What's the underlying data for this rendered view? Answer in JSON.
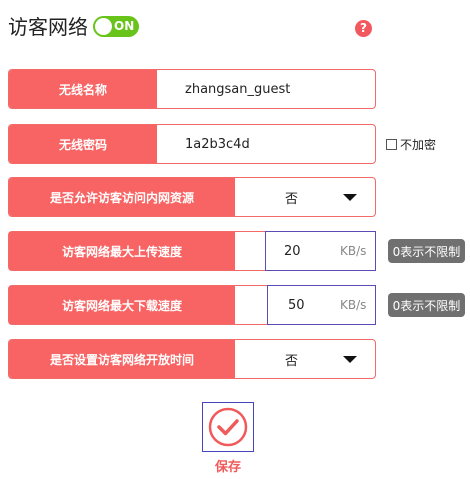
{
  "header": {
    "title": "访客网络",
    "toggle_label": "ON",
    "help_symbol": "?"
  },
  "fields": {
    "ssid_label": "无线名称",
    "ssid_value": "zhangsan_guest",
    "password_label": "无线密码",
    "password_value": "1a2b3c4d",
    "no_encrypt_label": "不加密",
    "allow_intranet_label": "是否允许访客访问内网资源",
    "allow_intranet_value": "否",
    "upload_label": "访客网络最大上传速度",
    "upload_value": "20",
    "upload_unit": "KB/s",
    "upload_hint": "0表示不限制",
    "download_label": "访客网络最大下载速度",
    "download_value": "50",
    "download_unit": "KB/s",
    "download_hint": "0表示不限制",
    "schedule_label": "是否设置访客网络开放时间",
    "schedule_value": "否"
  },
  "actions": {
    "save_label": "保存"
  },
  "colors": {
    "accent": "#f86464",
    "toggle_on": "#68c31a",
    "hint_bg": "#707070"
  }
}
